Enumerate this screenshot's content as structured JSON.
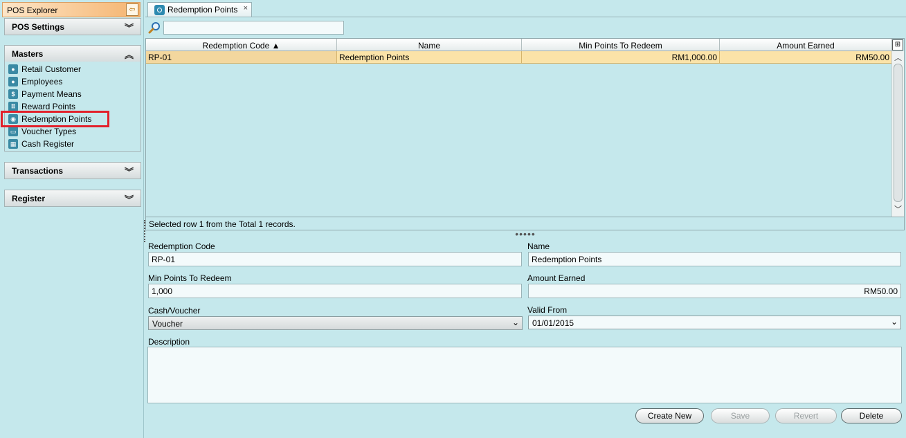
{
  "explorer": {
    "title": "POS Explorer",
    "sections": {
      "pos_settings": "POS Settings",
      "masters": "Masters",
      "transactions": "Transactions",
      "register": "Register"
    },
    "masters_items": [
      {
        "label": "Retail Customer",
        "icon": "retail-customer-icon"
      },
      {
        "label": "Employees",
        "icon": "employees-icon"
      },
      {
        "label": "Payment Means",
        "icon": "dollar-icon"
      },
      {
        "label": "Reward Points",
        "icon": "grid-icon"
      },
      {
        "label": "Redemption Points",
        "icon": "redemption-icon"
      },
      {
        "label": "Voucher Types",
        "icon": "voucher-icon"
      },
      {
        "label": "Cash Register",
        "icon": "cash-register-icon"
      }
    ]
  },
  "tab": {
    "label": "Redemption Points",
    "close": "×"
  },
  "search": {
    "value": ""
  },
  "grid": {
    "columns": [
      "Redemption Code ▲",
      "Name",
      "Min Points To Redeem",
      "Amount Earned"
    ],
    "rows": [
      [
        "RP-01",
        "Redemption Points",
        "RM1,000.00",
        "RM50.00"
      ]
    ]
  },
  "status": "Selected row 1 from the Total 1 records.",
  "splitter": "•••••",
  "form": {
    "redemption_code_label": "Redemption Code",
    "redemption_code_value": "RP-01",
    "name_label": "Name",
    "name_value": "Redemption Points",
    "min_points_label": "Min Points To Redeem",
    "min_points_value": "1,000",
    "amount_earned_label": "Amount Earned",
    "amount_earned_value": "RM50.00",
    "cash_voucher_label": "Cash/Voucher",
    "cash_voucher_value": "Voucher",
    "valid_from_label": "Valid From",
    "valid_from_value": "01/01/2015",
    "description_label": "Description",
    "description_value": ""
  },
  "buttons": {
    "create_new": "Create New",
    "save": "Save",
    "revert": "Revert",
    "delete": "Delete"
  },
  "colors": {
    "background": "#c5e8ec",
    "selected_row": "#fbe3a8",
    "highlight_box": "#e2202a"
  }
}
